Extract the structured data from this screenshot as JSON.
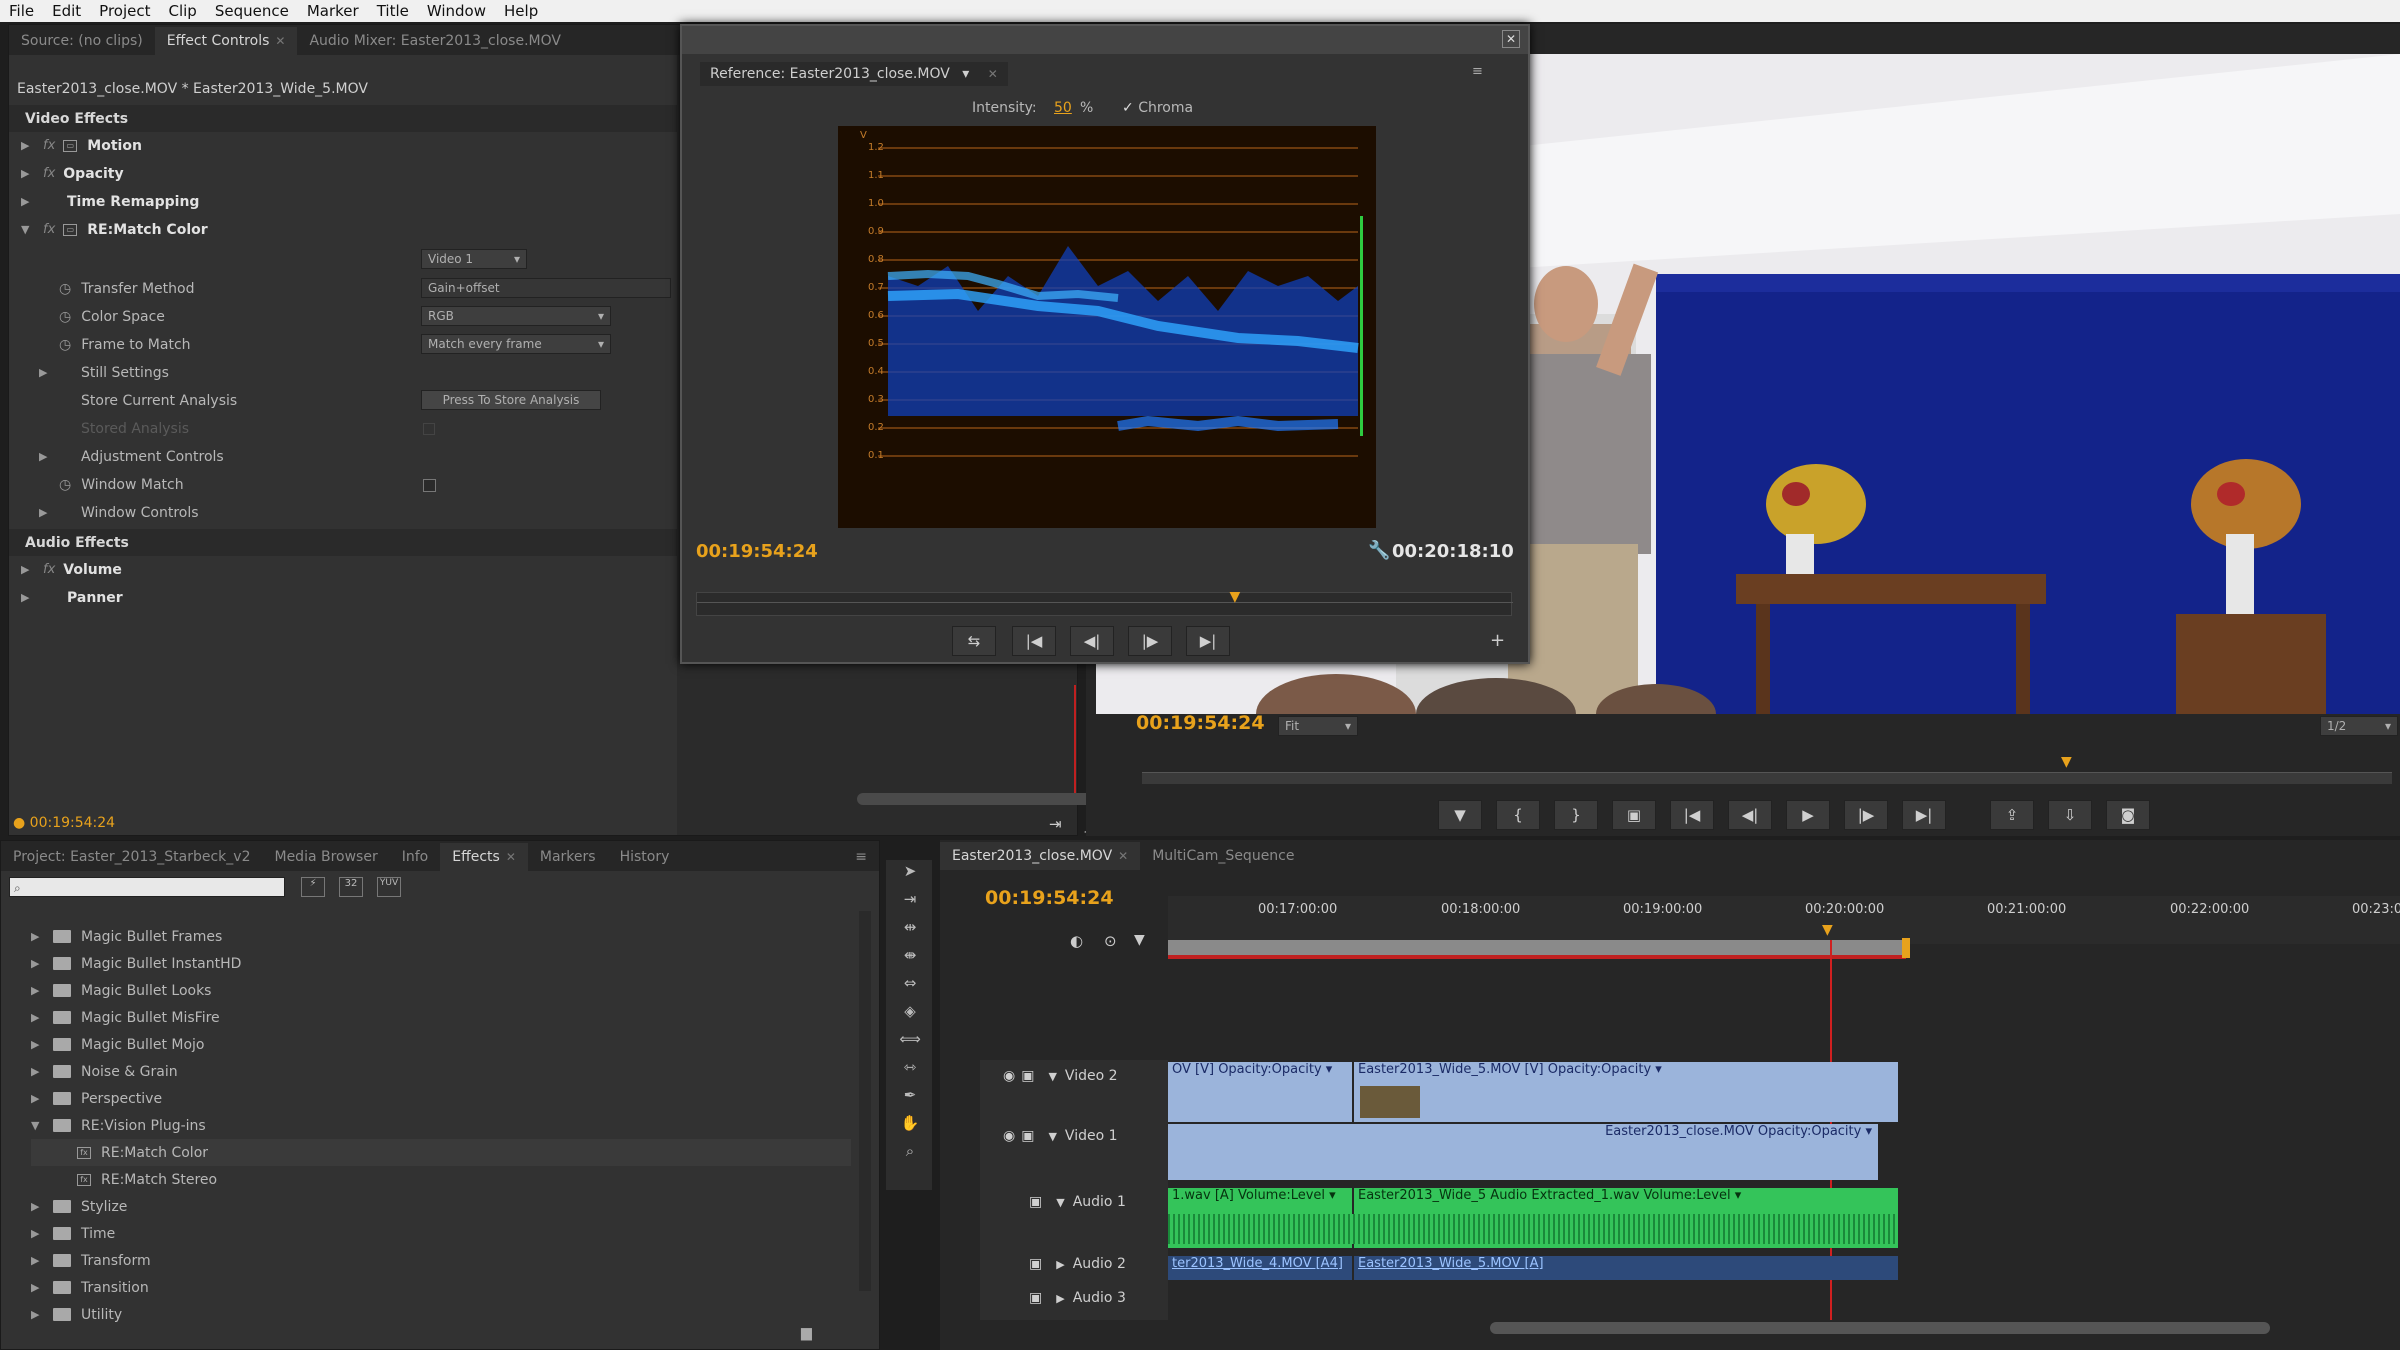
{
  "menu": [
    "File",
    "Edit",
    "Project",
    "Clip",
    "Sequence",
    "Marker",
    "Title",
    "Window",
    "Help"
  ],
  "top_tabs": {
    "source": "Source: (no clips)",
    "effect_controls": "Effect Controls",
    "audio_mixer": "Audio Mixer: Easter2013_close.MOV"
  },
  "effect_controls": {
    "clip_path": "Easter2013_close.MOV * Easter2013_Wide_5.MOV",
    "video_effects_label": "Video Effects",
    "motion": "Motion",
    "opacity": "Opacity",
    "time_remapping": "Time Remapping",
    "rematch": "RE:Match Color",
    "source_select": "Video 1",
    "params": [
      {
        "label": "Transfer Method",
        "value": "Gain+offset"
      },
      {
        "label": "Color Space",
        "value": "RGB"
      },
      {
        "label": "Frame to Match",
        "value": "Match every frame"
      },
      {
        "label": "Still Settings",
        "value": ""
      },
      {
        "label": "Store Current Analysis",
        "value": "Press To Store Analysis"
      },
      {
        "label": "Stored Analysis",
        "value": ""
      },
      {
        "label": "Adjustment Controls",
        "value": ""
      },
      {
        "label": "Window Match",
        "value": ""
      },
      {
        "label": "Window Controls",
        "value": ""
      }
    ],
    "audio_effects_label": "Audio Effects",
    "volume": "Volume",
    "panner": "Panner",
    "timecode": "00:19:54:24"
  },
  "reference": {
    "tab": "Reference: Easter2013_close.MOV",
    "intensity_label": "Intensity:",
    "intensity_value": "50",
    "intensity_unit": "%",
    "chroma_label": "Chroma",
    "chroma_checked": true,
    "scope_labels": [
      "1.2",
      "1.1",
      "1.0",
      "0.9",
      "0.8",
      "0.7",
      "0.6",
      "0.5",
      "0.4",
      "0.3",
      "0.2",
      "0.1"
    ],
    "scope_v": "V",
    "timecode_left": "00:19:54:24",
    "timecode_right": "00:20:18:10",
    "playhead_fraction": 0.66,
    "colors": {
      "scope_trace": "#1e7bff",
      "grid": "#b8651a"
    }
  },
  "program": {
    "timecode": "00:19:54:24",
    "zoom": "Fit",
    "resolution": "1/2",
    "playhead_fraction": 0.74
  },
  "project_tabs": [
    {
      "label": "Project: Easter_2013_Starbeck_v2"
    },
    {
      "label": "Media Browser"
    },
    {
      "label": "Info"
    },
    {
      "label": "Effects"
    },
    {
      "label": "Markers"
    },
    {
      "label": "History"
    }
  ],
  "effects_tree": [
    {
      "label": "Magic Bullet Frames",
      "type": "folder",
      "depth": 0
    },
    {
      "label": "Magic Bullet InstantHD",
      "type": "folder",
      "depth": 0
    },
    {
      "label": "Magic Bullet Looks",
      "type": "folder",
      "depth": 0
    },
    {
      "label": "Magic Bullet MisFire",
      "type": "folder",
      "depth": 0
    },
    {
      "label": "Magic Bullet Mojo",
      "type": "folder",
      "depth": 0
    },
    {
      "label": "Noise & Grain",
      "type": "folder",
      "depth": 0
    },
    {
      "label": "Perspective",
      "type": "folder",
      "depth": 0
    },
    {
      "label": "RE:Vision Plug-ins",
      "type": "folder-open",
      "depth": 0
    },
    {
      "label": "RE:Match Color",
      "type": "effect",
      "depth": 1
    },
    {
      "label": "RE:Match Stereo",
      "type": "effect",
      "depth": 1
    },
    {
      "label": "Stylize",
      "type": "folder",
      "depth": 0
    },
    {
      "label": "Time",
      "type": "folder",
      "depth": 0
    },
    {
      "label": "Transform",
      "type": "folder",
      "depth": 0
    },
    {
      "label": "Transition",
      "type": "folder",
      "depth": 0
    },
    {
      "label": "Utility",
      "type": "folder",
      "depth": 0
    }
  ],
  "timeline": {
    "tabs": [
      "Easter2013_close.MOV",
      "MultiCam_Sequence"
    ],
    "timecode": "00:19:54:24",
    "ruler": [
      "00:17:00:00",
      "00:18:00:00",
      "00:19:00:00",
      "00:20:00:00",
      "00:21:00:00",
      "00:22:00:00",
      "00:23:0"
    ],
    "tracks": {
      "video2": "Video 2",
      "video1": "Video 1",
      "audio1": "Audio 1",
      "audio2": "Audio 2",
      "audio3": "Audio 3"
    },
    "clips": {
      "v2a": "OV [V]  Opacity:Opacity ▾",
      "v2b": "Easter2013_Wide_5.MOV [V]  Opacity:Opacity ▾",
      "v1": "Easter2013_close.MOV  Opacity:Opacity ▾",
      "a1a": "1.wav [A]  Volume:Level ▾",
      "a1b": "Easter2013_Wide_5 Audio Extracted_1.wav  Volume:Level ▾",
      "a2a": "ter2013_Wide_4.MOV [A4]",
      "a2b": "Easter2013_Wide_5.MOV [A]"
    }
  }
}
